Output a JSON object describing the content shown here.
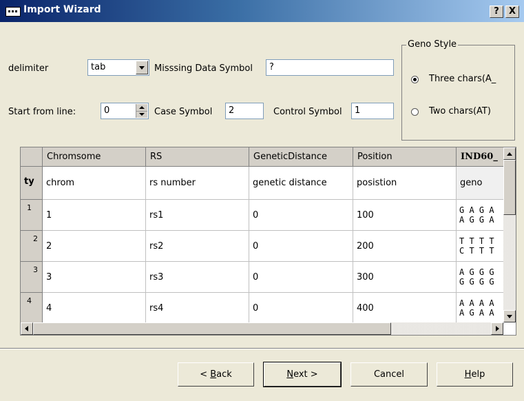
{
  "window": {
    "title": "Import Wizard",
    "help_btn": "?",
    "close_btn": "X"
  },
  "options": {
    "delimiter_label": "delimiter",
    "delimiter_value": "tab",
    "missing_label": "Misssing Data Symbol",
    "missing_value": "?",
    "start_label": "Start from line:",
    "start_value": "0",
    "case_label": "Case Symbol",
    "case_value": "2",
    "control_label": "Control Symbol",
    "control_value": "1"
  },
  "geno_style": {
    "legend": "Geno Style",
    "options": [
      {
        "label": "Three chars(A_",
        "selected": true
      },
      {
        "label": "Two chars(AT)",
        "selected": false
      }
    ]
  },
  "grid": {
    "columns": [
      "Chromsome",
      "RS",
      "GeneticDistance",
      "Position",
      "IND60_"
    ],
    "type_row": {
      "header": "ty",
      "cells": [
        "chrom",
        "rs number",
        "genetic distance",
        "posistion",
        "geno"
      ]
    },
    "rows": [
      {
        "header": "1",
        "cells": [
          "1",
          "rs1",
          "0",
          "100"
        ],
        "geno": "G A G A\nA G G A"
      },
      {
        "header": "2",
        "cells": [
          "2",
          "rs2",
          "0",
          "200"
        ],
        "geno": "T T T T\nC T T T"
      },
      {
        "header": "3",
        "cells": [
          "3",
          "rs3",
          "0",
          "300"
        ],
        "geno": "A G G G\nG G G G"
      },
      {
        "header": "4",
        "cells": [
          "4",
          "rs4",
          "0",
          "400"
        ],
        "geno": "A A A A\nA G A A"
      }
    ]
  },
  "buttons": {
    "back": {
      "pre": "< ",
      "acc": "B",
      "post": "ack"
    },
    "next": {
      "pre": "",
      "acc": "N",
      "post": "ext >"
    },
    "cancel": "Cancel",
    "help": {
      "pre": "",
      "acc": "H",
      "post": "elp"
    }
  }
}
